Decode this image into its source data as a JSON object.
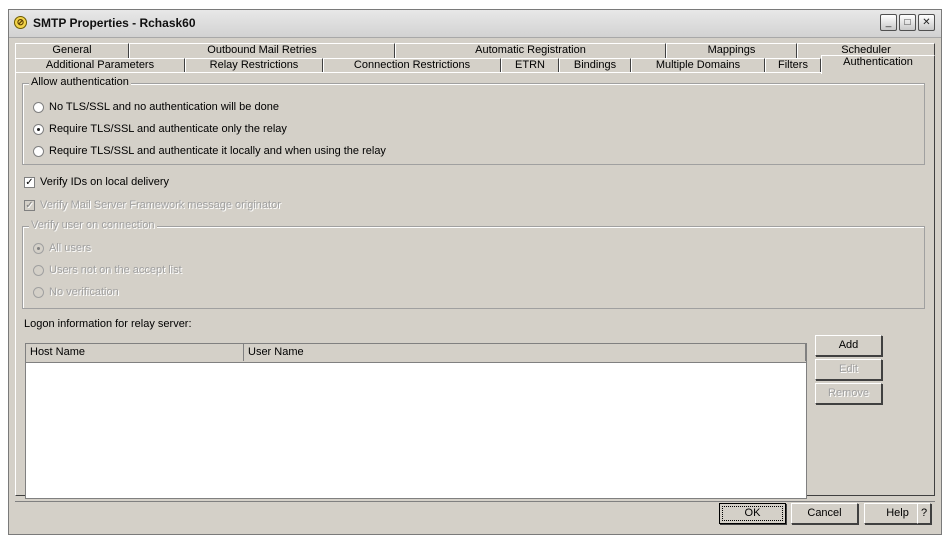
{
  "window": {
    "title": "SMTP Properties - Rchask60"
  },
  "tabs_row1": [
    "General",
    "Outbound Mail Retries",
    "Automatic Registration",
    "Mappings",
    "Scheduler"
  ],
  "tabs_row2": [
    "Additional Parameters",
    "Relay Restrictions",
    "Connection Restrictions",
    "ETRN",
    "Bindings",
    "Multiple Domains",
    "Filters",
    "Authentication"
  ],
  "active_tab": "Authentication",
  "allow_auth": {
    "legend": "Allow authentication",
    "options": [
      "No TLS/SSL and no authentication will be done",
      "Require TLS/SSL and authenticate only the relay",
      "Require TLS/SSL and authenticate it locally and when using the relay"
    ],
    "selected_index": 1
  },
  "verify_ids": {
    "label": "Verify IDs on local delivery",
    "checked": true
  },
  "verify_mail": {
    "label": "Verify Mail Server Framework message originator",
    "checked": true,
    "enabled": false
  },
  "verify_user": {
    "legend": "Verify user on connection",
    "options": [
      "All users",
      "Users not on the accept list",
      "No verification"
    ],
    "selected_index": 0,
    "enabled": false
  },
  "logon": {
    "label": "Logon information for relay server:",
    "columns": [
      "Host Name",
      "User Name"
    ],
    "rows": []
  },
  "side_buttons": {
    "add": "Add",
    "edit": "Edit",
    "remove": "Remove"
  },
  "footer": {
    "ok": "OK",
    "cancel": "Cancel",
    "help": "Help",
    "whats_this": "?"
  },
  "icons": {
    "title": "smtp-app-icon",
    "minimize": "minimize-icon",
    "maximize": "maximize-icon",
    "close": "close-icon"
  }
}
